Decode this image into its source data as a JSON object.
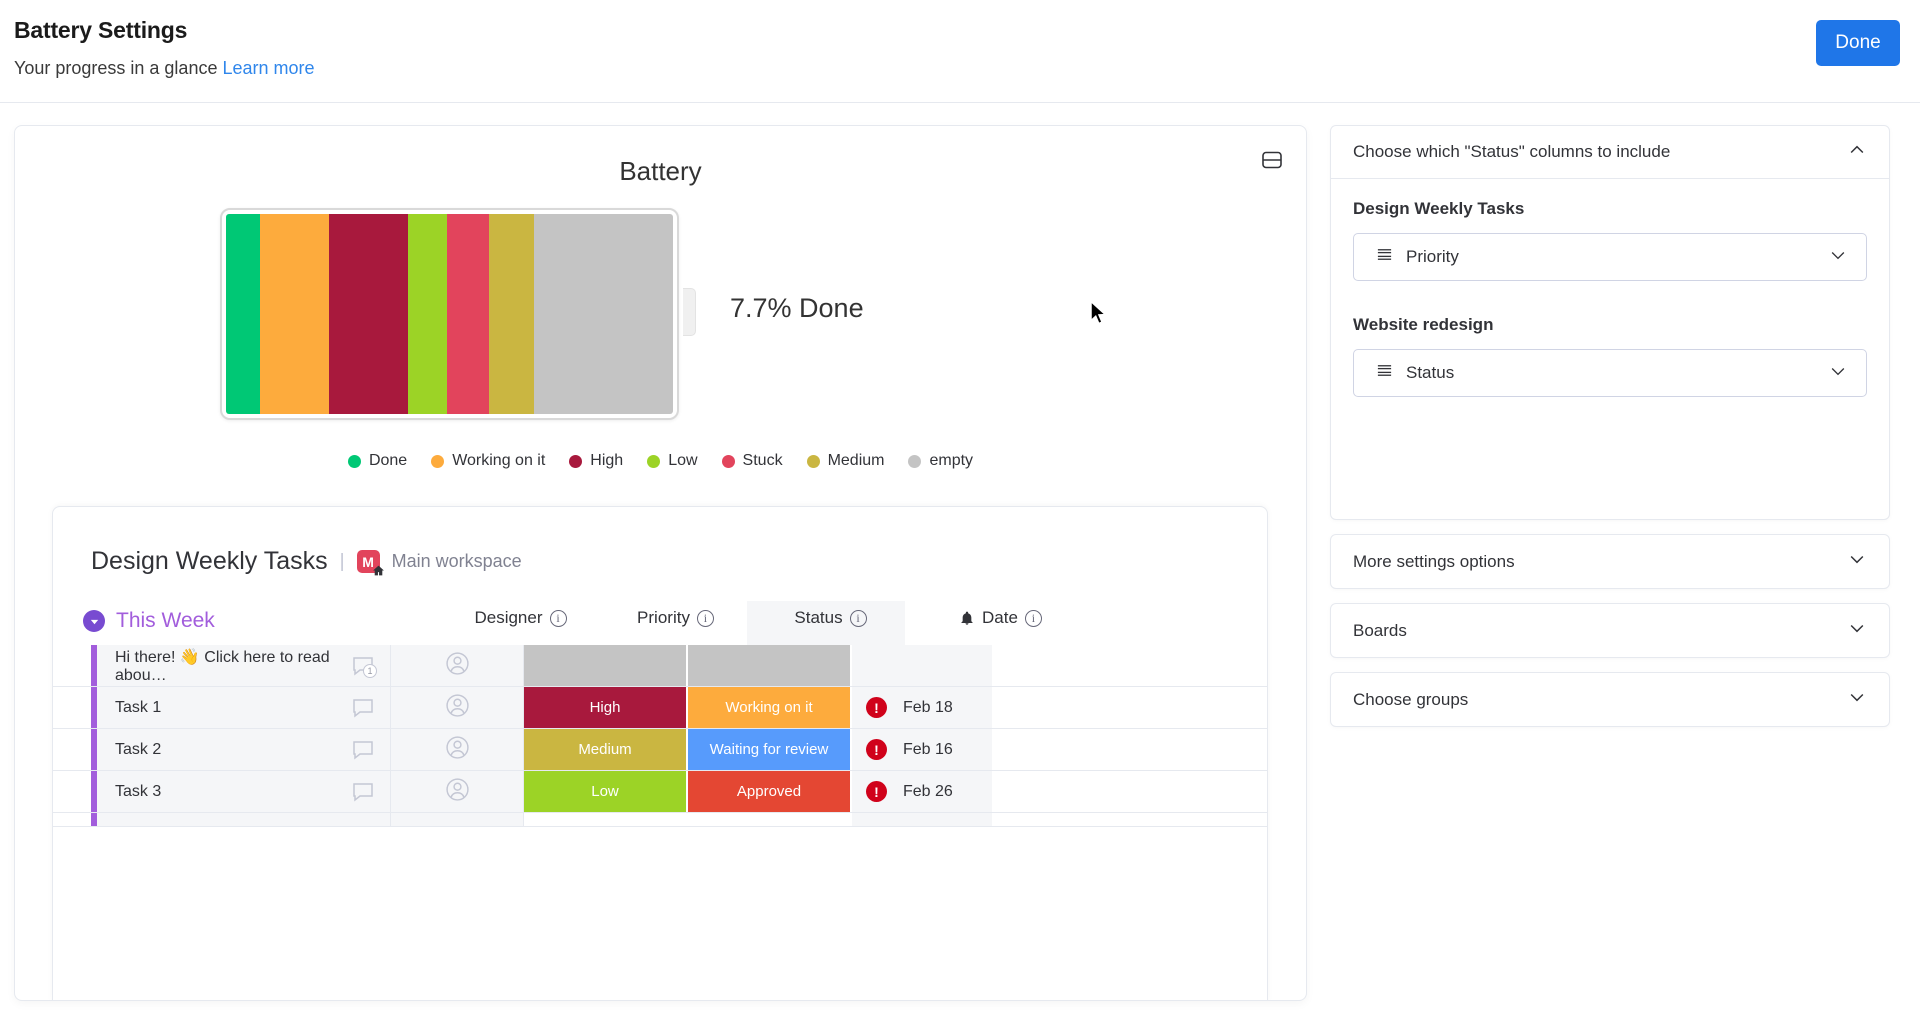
{
  "header": {
    "title": "Battery Settings",
    "subtitle": "Your progress in a glance",
    "learn_more": "Learn more",
    "done_label": "Done"
  },
  "widget": {
    "title": "Battery",
    "menu_icon": "collapse-widget-icon",
    "percent_label": "7.7% Done"
  },
  "chart_data": {
    "type": "bar",
    "title": "Battery",
    "subtype": "stacked-horizontal-battery",
    "categories": [
      "Done",
      "Working on it",
      "High",
      "Low",
      "Stuck",
      "Medium",
      "empty"
    ],
    "values": [
      7.7,
      15.4,
      17.6,
      8.8,
      9.4,
      9.9,
      31.2
    ],
    "unit": "percent",
    "colors": [
      "#00c875",
      "#fdab3d",
      "#a8193d",
      "#9cd326",
      "#e2445c",
      "#cab641",
      "#c4c4c4"
    ],
    "total": 100,
    "completed_label": "7.7% Done",
    "legend_position": "bottom",
    "grid": false
  },
  "legend": [
    {
      "label": "Done",
      "color": "#00c875"
    },
    {
      "label": "Working on it",
      "color": "#fdab3d"
    },
    {
      "label": "High",
      "color": "#a8193d"
    },
    {
      "label": "Low",
      "color": "#9cd326"
    },
    {
      "label": "Stuck",
      "color": "#e2445c"
    },
    {
      "label": "Medium",
      "color": "#cab641"
    },
    {
      "label": "empty",
      "color": "#c4c4c4"
    }
  ],
  "board": {
    "name": "Design Weekly Tasks",
    "separator": "|",
    "workspace_initial": "M",
    "workspace_label": "Main workspace",
    "group_name": "This Week",
    "columns": [
      {
        "label": "Designer",
        "info": "i"
      },
      {
        "label": "Priority",
        "info": "i"
      },
      {
        "label": "Status",
        "info": "i"
      },
      {
        "label": "Date",
        "info": "i"
      }
    ],
    "rows": [
      {
        "name": "Hi there! 👋 Click here to read abou…",
        "comments": "1",
        "priority": "",
        "priority_color": "#c4c4c4",
        "status": "",
        "status_color": "#c4c4c4",
        "date": "",
        "alert": ""
      },
      {
        "name": "Task 1",
        "comments": "",
        "priority": "High",
        "priority_color": "#a8193d",
        "status": "Working on it",
        "status_color": "#fdab3d",
        "date": "Feb 18",
        "alert": "!"
      },
      {
        "name": "Task 2",
        "comments": "",
        "priority": "Medium",
        "priority_color": "#cab641",
        "status": "Waiting for review",
        "status_color": "#579bfc",
        "date": "Feb 16",
        "alert": "!"
      },
      {
        "name": "Task 3",
        "comments": "",
        "priority": "Low",
        "priority_color": "#9cd326",
        "status": "Approved",
        "status_color": "#e44733",
        "date": "Feb 26",
        "alert": "!"
      }
    ]
  },
  "settings": {
    "status_section_title": "Choose which \"Status\" columns to include",
    "board_1_label": "Design Weekly Tasks",
    "board_1_value": "Priority",
    "board_2_label": "Website redesign",
    "board_2_value": "Status",
    "more_settings": "More settings options",
    "boards": "Boards",
    "choose_groups": "Choose groups"
  },
  "colors": {
    "accent": "#1f76e8",
    "link": "#2f86eb",
    "group": "#a25ddc",
    "alert": "#d0021b"
  }
}
